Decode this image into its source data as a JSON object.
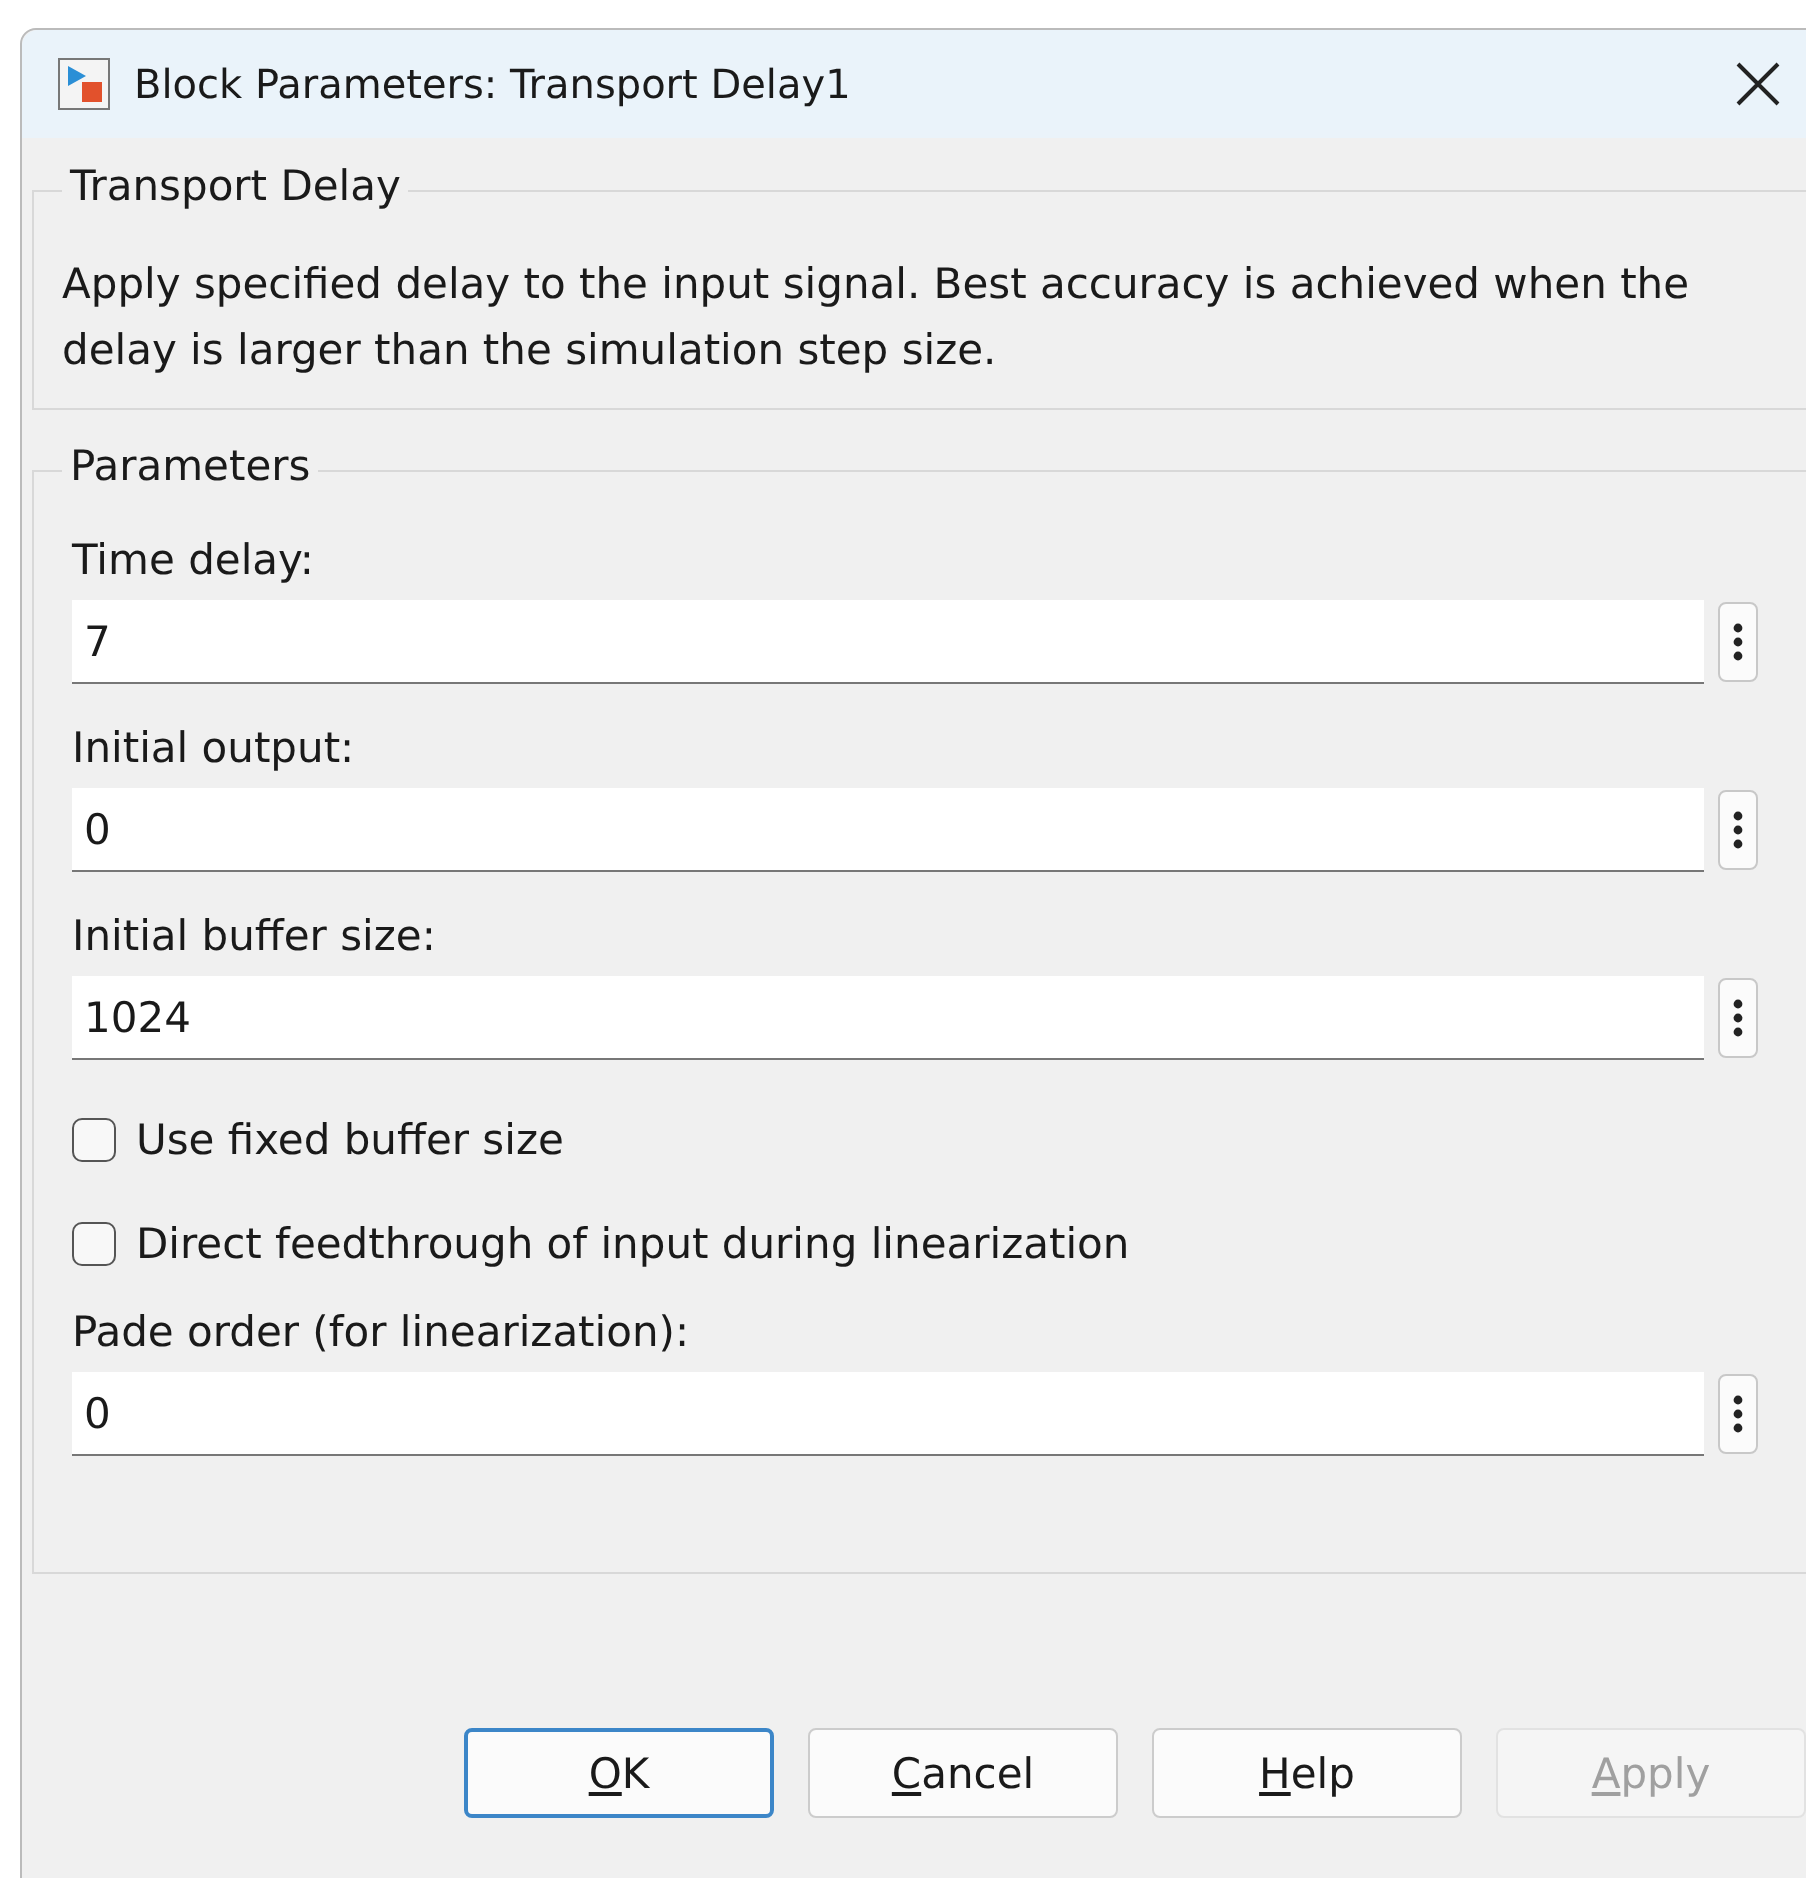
{
  "window": {
    "title": "Block Parameters: Transport Delay1"
  },
  "description_group": {
    "title": "Transport Delay",
    "text": "Apply specified delay to the input signal.  Best accuracy is achieved when the delay is larger than the simulation step size."
  },
  "parameters_group": {
    "title": "Parameters",
    "items": [
      {
        "kind": "field",
        "label": "Time delay:",
        "value": "7"
      },
      {
        "kind": "field",
        "label": "Initial output:",
        "value": "0"
      },
      {
        "kind": "field",
        "label": "Initial buffer size:",
        "value": "1024"
      },
      {
        "kind": "checkbox",
        "label": "Use fixed buffer size",
        "checked": false
      },
      {
        "kind": "checkbox",
        "label": "Direct feedthrough of input during linearization",
        "checked": false
      },
      {
        "kind": "field",
        "label": "Pade order (for linearization):",
        "value": "0"
      }
    ]
  },
  "buttons": [
    {
      "key": "O",
      "rest": "K",
      "default": true,
      "disabled": false
    },
    {
      "key": "C",
      "rest": "ancel",
      "default": false,
      "disabled": false
    },
    {
      "key": "H",
      "rest": "elp",
      "default": false,
      "disabled": false
    },
    {
      "key": "A",
      "rest": "pply",
      "default": false,
      "disabled": true
    }
  ]
}
